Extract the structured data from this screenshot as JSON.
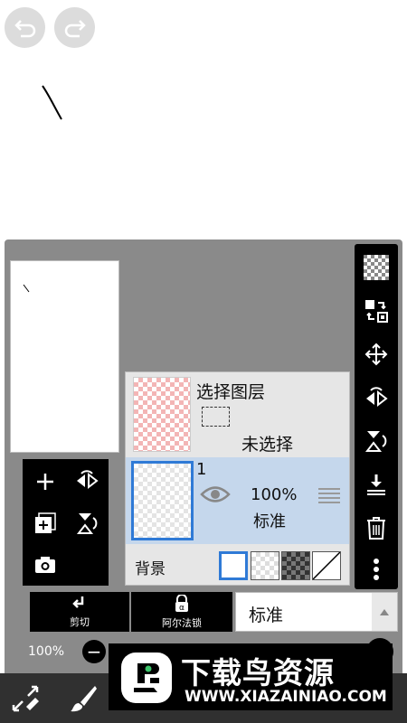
{
  "top": {
    "undo_icon": "undo-icon",
    "redo_icon": "redo-icon"
  },
  "layers_panel": {
    "selection_layer": {
      "title": "选择图层",
      "status": "未选择"
    },
    "layer1": {
      "number": "1",
      "opacity": "100%",
      "blend_mode": "标准"
    },
    "background": {
      "label": "背景",
      "options": [
        "white",
        "checker",
        "dark-checker",
        "transparent"
      ],
      "selected": "white"
    },
    "clipping_label": "剪切",
    "alpha_lock_label": "阿尔法锁",
    "blend_select_value": "标准",
    "opacity_slider": {
      "label": "100%",
      "value": 100
    }
  },
  "right_bar_icons": [
    "checker-icon",
    "swap-layer-icon",
    "move-icon",
    "flip-horizontal-icon",
    "flip-vertical-icon",
    "merge-down-icon",
    "trash-icon",
    "more-icon"
  ],
  "layer_tool_icons": [
    "add-layer-icon",
    "flip-horizontal-icon",
    "duplicate-layer-icon",
    "flip-vertical-icon",
    "camera-icon"
  ],
  "toolbar_icons": [
    "transform-icon",
    "brush-icon"
  ],
  "watermark": {
    "title": "下载鸟资源",
    "url": "WWW.XIAZAINIAO.COM"
  },
  "colors": {
    "accent": "#2f7ad6",
    "panel": "#8a8a8a",
    "selection_checker": "#f3b5b5",
    "layer_selected": "#c5d7ec"
  }
}
